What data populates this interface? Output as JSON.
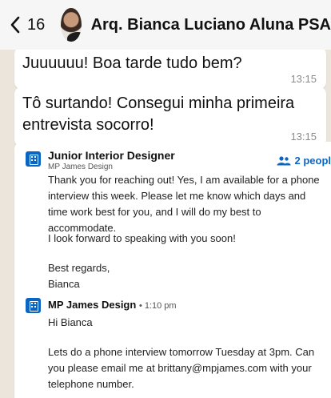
{
  "header": {
    "back_count": "16",
    "contact_name": "Arq. Bianca Luciano Aluna PSA"
  },
  "messages": [
    {
      "text": "Juuuuuu! Boa tarde tudo bem?",
      "time": "13:15"
    },
    {
      "text": "Tô surtando! Consegui minha primeira entrevista socorro!",
      "time": "13:15"
    }
  ],
  "linkedin_card": {
    "job_title": "Junior Interior Designer",
    "company": "MP James Design",
    "people": "2 peopl",
    "reply_text": "Thank you for reaching out! Yes, I am available for a phone interview this week. Please let me know which days and time work best for you, and I will do my best to accommodate.",
    "closing": "I look forward to speaking with you soon!",
    "sign_off": "Best regards,",
    "signature": "Bianca",
    "sender_name": "MP James Design",
    "sender_time": "• 1:10 pm",
    "greeting": "Hi Bianca",
    "body": "Lets do a phone interview tomorrow Tuesday at 3pm. Can you please email me at brittany@mpjames.com with your telephone number."
  }
}
